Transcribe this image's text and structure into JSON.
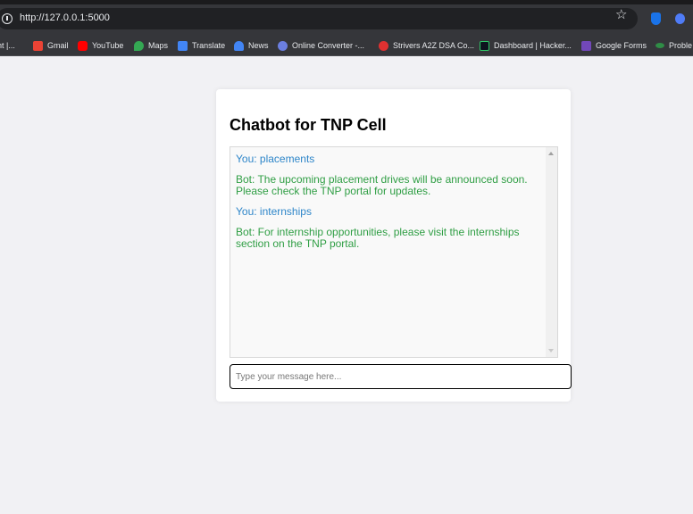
{
  "browser": {
    "url": "http://127.0.0.1:5000",
    "bookmarks": [
      {
        "label": "nt |...",
        "icon": "doc-icon",
        "color": "#35363a"
      },
      {
        "label": "Gmail",
        "icon": "gmail-icon",
        "color": "#ea4335"
      },
      {
        "label": "YouTube",
        "icon": "youtube-icon",
        "color": "#ff0000"
      },
      {
        "label": "Maps",
        "icon": "maps-icon",
        "color": "#34a853"
      },
      {
        "label": "Translate",
        "icon": "translate-icon",
        "color": "#4285f4"
      },
      {
        "label": "News",
        "icon": "news-icon",
        "color": "#4285f4"
      },
      {
        "label": "Online Converter -...",
        "icon": "converter-icon",
        "color": "#6b7fe0"
      },
      {
        "label": "Strivers A2Z DSA Co...",
        "icon": "tuf-icon",
        "color": "#e03131"
      },
      {
        "label": "Dashboard | Hacker...",
        "icon": "hackerrank-icon",
        "color": "#2ec866"
      },
      {
        "label": "Google Forms",
        "icon": "forms-icon",
        "color": "#7248b9"
      },
      {
        "label": "Proble",
        "icon": "gfg-icon",
        "color": "#2f8d46"
      }
    ]
  },
  "chat": {
    "title": "Chatbot for TNP Cell",
    "messages": [
      {
        "sender": "user",
        "text": "You: placements"
      },
      {
        "sender": "bot",
        "text": "Bot: The upcoming placement drives will be announced soon. Please check the TNP portal for updates."
      },
      {
        "sender": "user",
        "text": "You: internships"
      },
      {
        "sender": "bot",
        "text": "Bot: For internship opportunities, please visit the internships section on the TNP portal."
      }
    ],
    "input_placeholder": "Type your message here..."
  },
  "colors": {
    "user_text": "#2e86c9",
    "bot_text": "#2f9e44",
    "page_background": "#f1f1f4"
  }
}
